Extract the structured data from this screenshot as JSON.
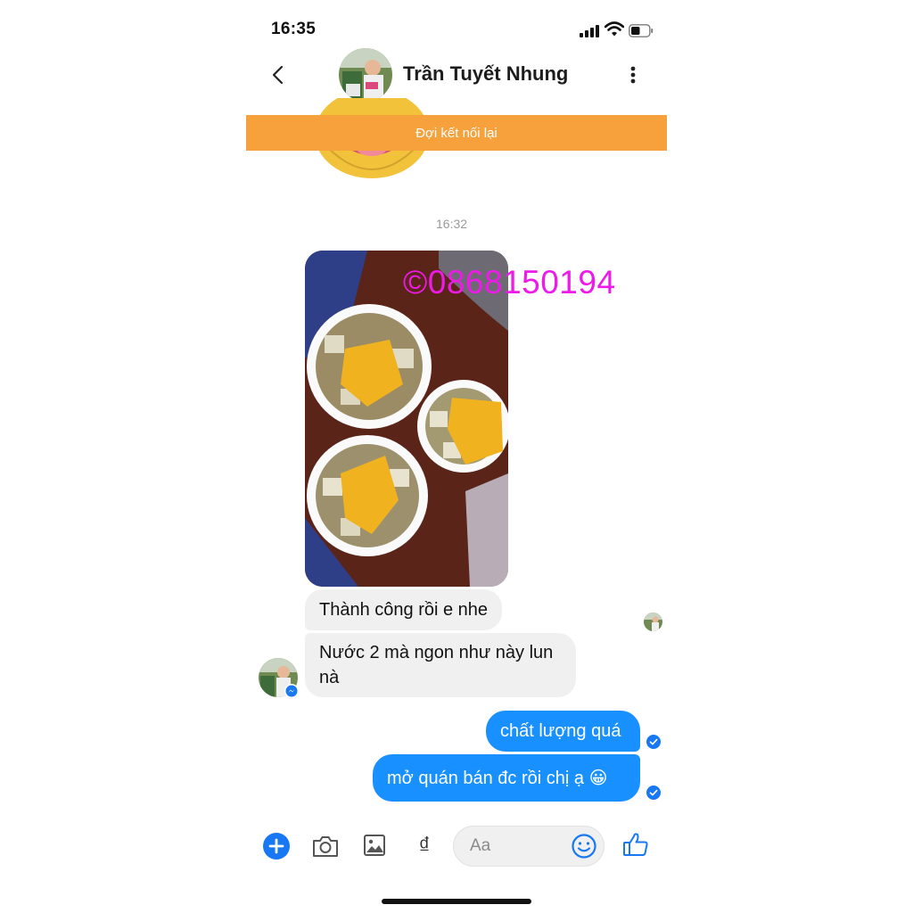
{
  "status_bar": {
    "time": "16:35",
    "icons": [
      "signal-icon",
      "wifi-icon",
      "battery-icon"
    ]
  },
  "header": {
    "contact_name": "Trần Tuyết Nhung",
    "icons": [
      "back-chevron-icon",
      "more-vertical-icon"
    ]
  },
  "banner": {
    "text": "Đợi kết nối lại",
    "color": "#f7a13c"
  },
  "conversation": {
    "timestamp": "16:32",
    "photo_watermark": "©0868150194",
    "incoming": [
      {
        "text": "Thành công rồi e nhe"
      },
      {
        "text": "Nước 2 mà ngon như này lun nà"
      }
    ],
    "outgoing": [
      {
        "text": "chất lượng quá"
      },
      {
        "text": "mở quán bán đc rồi chị ạ 😀"
      }
    ],
    "outgoing_color": "#1890ff"
  },
  "composer": {
    "placeholder": "Aa",
    "currency_symbol": "₫",
    "icons": [
      "plus-icon",
      "camera-icon",
      "gallery-icon",
      "currency-icon",
      "emoji-icon",
      "thumbs-up-icon"
    ],
    "accent_color": "#1877f2"
  }
}
